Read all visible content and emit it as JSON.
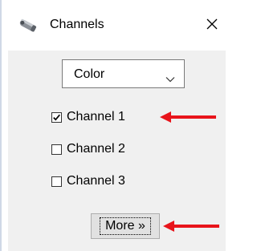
{
  "window": {
    "title": "Channels",
    "icon": "microscope-icon",
    "close_icon": "close-icon"
  },
  "select": {
    "value": "Color",
    "arrow_icon": "chevron-down-icon"
  },
  "channels": [
    {
      "label": "Channel 1",
      "checked": true
    },
    {
      "label": "Channel 2",
      "checked": false
    },
    {
      "label": "Channel 3",
      "checked": false
    }
  ],
  "more_button": {
    "label": "More »"
  },
  "annotations": {
    "arrow_color": "#e8141b",
    "arrow_icon": "red-arrow-left-icon"
  },
  "colors": {
    "client_background": "#f0f0f0",
    "titlebar_background": "#ffffff",
    "window_border": "#cfd8e6"
  }
}
